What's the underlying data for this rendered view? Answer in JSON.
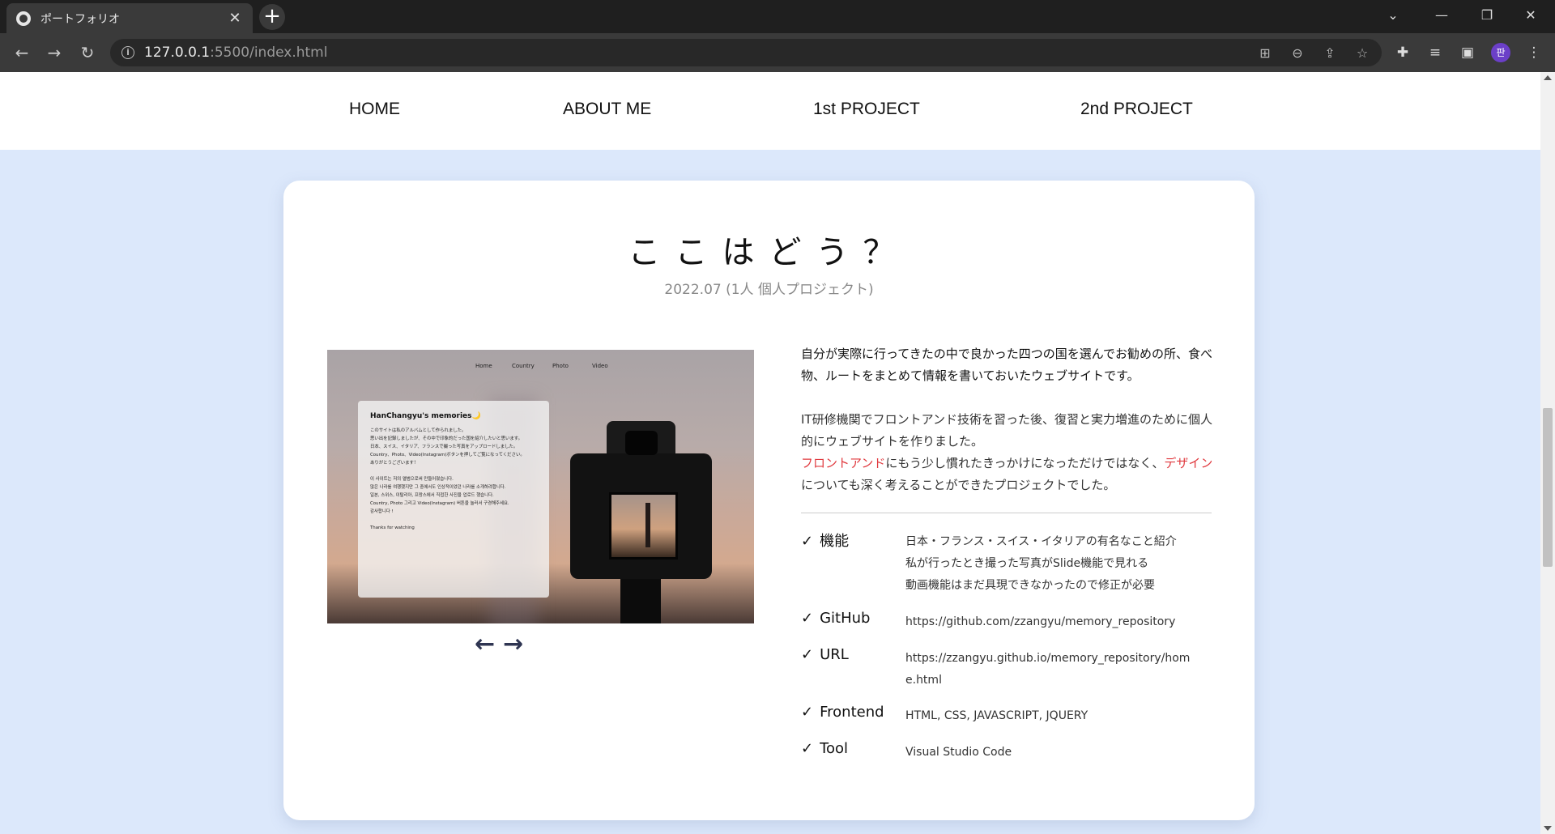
{
  "browser": {
    "tab_title": "ポートフォリオ",
    "tab_close": "✕",
    "new_tab": "+",
    "url_host": "127.0.0.1",
    "url_path": ":5500/index.html",
    "avatar_initial": "판",
    "window_controls": [
      "⌄",
      "—",
      "❐",
      "✕"
    ]
  },
  "sitenav": {
    "items": [
      "HOME",
      "ABOUT ME",
      "1st PROJECT",
      "2nd PROJECT"
    ]
  },
  "project": {
    "title": "ここはどう？",
    "date": "2022.07 (1人 個人プロジェクト)",
    "screenshot": {
      "nav": [
        "Home",
        "Country",
        "Photo",
        "Video"
      ],
      "heading": "HanChangyu's memories🌙",
      "body": "このサイトは私のアルバムとして作られました。\n思い出を記録しましたが、その中で印象的だった国を紹介したいと思います。\n日本、スイス、イタリア、フランスで撮った写真をアップロードしました。\nCountry、Photo、Video(Instagram)ボタンを押してご覧になってください。\nありがとうございます！\n\n이 사이트는 저의 앨범으로써 만들어졌습니다.\n많은 나라를 여행했지만 그 중에서도 인상적이었던 나라를 소개하려합니다.\n일본, 스위스, 이탈리아, 프랑스에서 직접한 사진을 업로드 했습니다.\nCountry, Photo 그리고 Video(Instagram) 버튼을 눌러서 구경해주세요.\n감사합니다 !\n\nThanks for watching"
    },
    "arrows": {
      "prev": "←",
      "next": "→"
    },
    "description": {
      "p1": "自分が実際に行ってきたの中で良かった四つの国を選んでお勧めの所、食べ物、ルートをまとめて情報を書いておいたウェブサイトです。",
      "p2_a": "IT研修機関でフロントアンド技術を習った後、復習と実力増進のために個人的にウェブサイトを作りました。",
      "p2_red1": "フロントアンド",
      "p2_b": "にもう少し慣れたきっかけになっただけではなく、",
      "p2_red2": "デザイン",
      "p2_c": "についても深く考えることができたプロジェクトでした。"
    },
    "check": "✓",
    "specs": [
      {
        "key": "機能",
        "value": "日本・フランス・スイス・イタリアの有名なこと紹介\n私が行ったとき撮った写真がSlide機能で見れる\n動画機能はまだ具現できなかったので修正が必要"
      },
      {
        "key": "GitHub",
        "value": "https://github.com/zzangyu/memory_repository"
      },
      {
        "key": "URL",
        "value": "https://zzangyu.github.io/memory_repository/home.html"
      },
      {
        "key": "Frontend",
        "value": "HTML, CSS, JAVASCRIPT, JQUERY"
      },
      {
        "key": "Tool",
        "value": "Visual Studio Code"
      }
    ]
  },
  "colors": {
    "page_bg": "#dce8fb",
    "accent_red": "#e0393e",
    "arrow": "#2f3552"
  }
}
